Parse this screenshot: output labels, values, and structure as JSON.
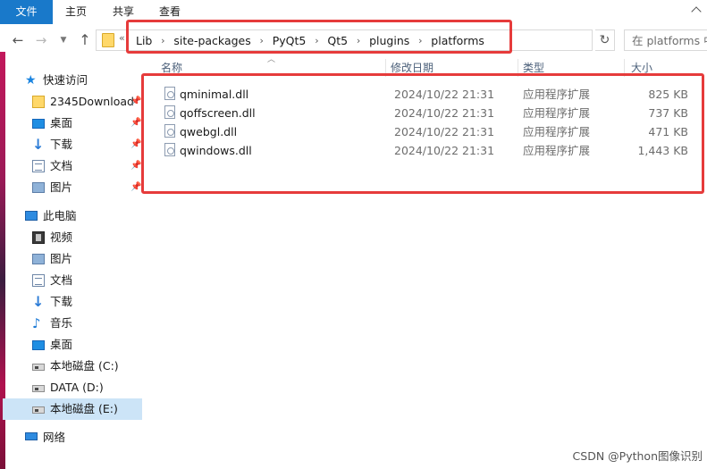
{
  "ribbon": {
    "tabs": [
      "文件",
      "主页",
      "共享",
      "查看"
    ]
  },
  "address": {
    "overflow": "«",
    "crumbs": [
      "Lib",
      "site-packages",
      "PyQt5",
      "Qt5",
      "plugins",
      "platforms"
    ],
    "search_placeholder": "在 platforms 中"
  },
  "columns": {
    "name": "名称",
    "date": "修改日期",
    "type": "类型",
    "size": "大小"
  },
  "files": [
    {
      "name": "qminimal.dll",
      "date": "2024/10/22 21:31",
      "type": "应用程序扩展",
      "size": "825 KB"
    },
    {
      "name": "qoffscreen.dll",
      "date": "2024/10/22 21:31",
      "type": "应用程序扩展",
      "size": "737 KB"
    },
    {
      "name": "qwebgl.dll",
      "date": "2024/10/22 21:31",
      "type": "应用程序扩展",
      "size": "471 KB"
    },
    {
      "name": "qwindows.dll",
      "date": "2024/10/22 21:31",
      "type": "应用程序扩展",
      "size": "1,443 KB"
    }
  ],
  "nav": {
    "quick_access": "快速访问",
    "quick_items": [
      "2345Download",
      "桌面",
      "下载",
      "文档",
      "图片"
    ],
    "this_pc": "此电脑",
    "pc_items": [
      "视频",
      "图片",
      "文档",
      "下载",
      "音乐",
      "桌面",
      "本地磁盘 (C:)",
      "DATA (D:)",
      "本地磁盘 (E:)"
    ],
    "network": "网络"
  },
  "watermark": "CSDN @Python图像识别"
}
